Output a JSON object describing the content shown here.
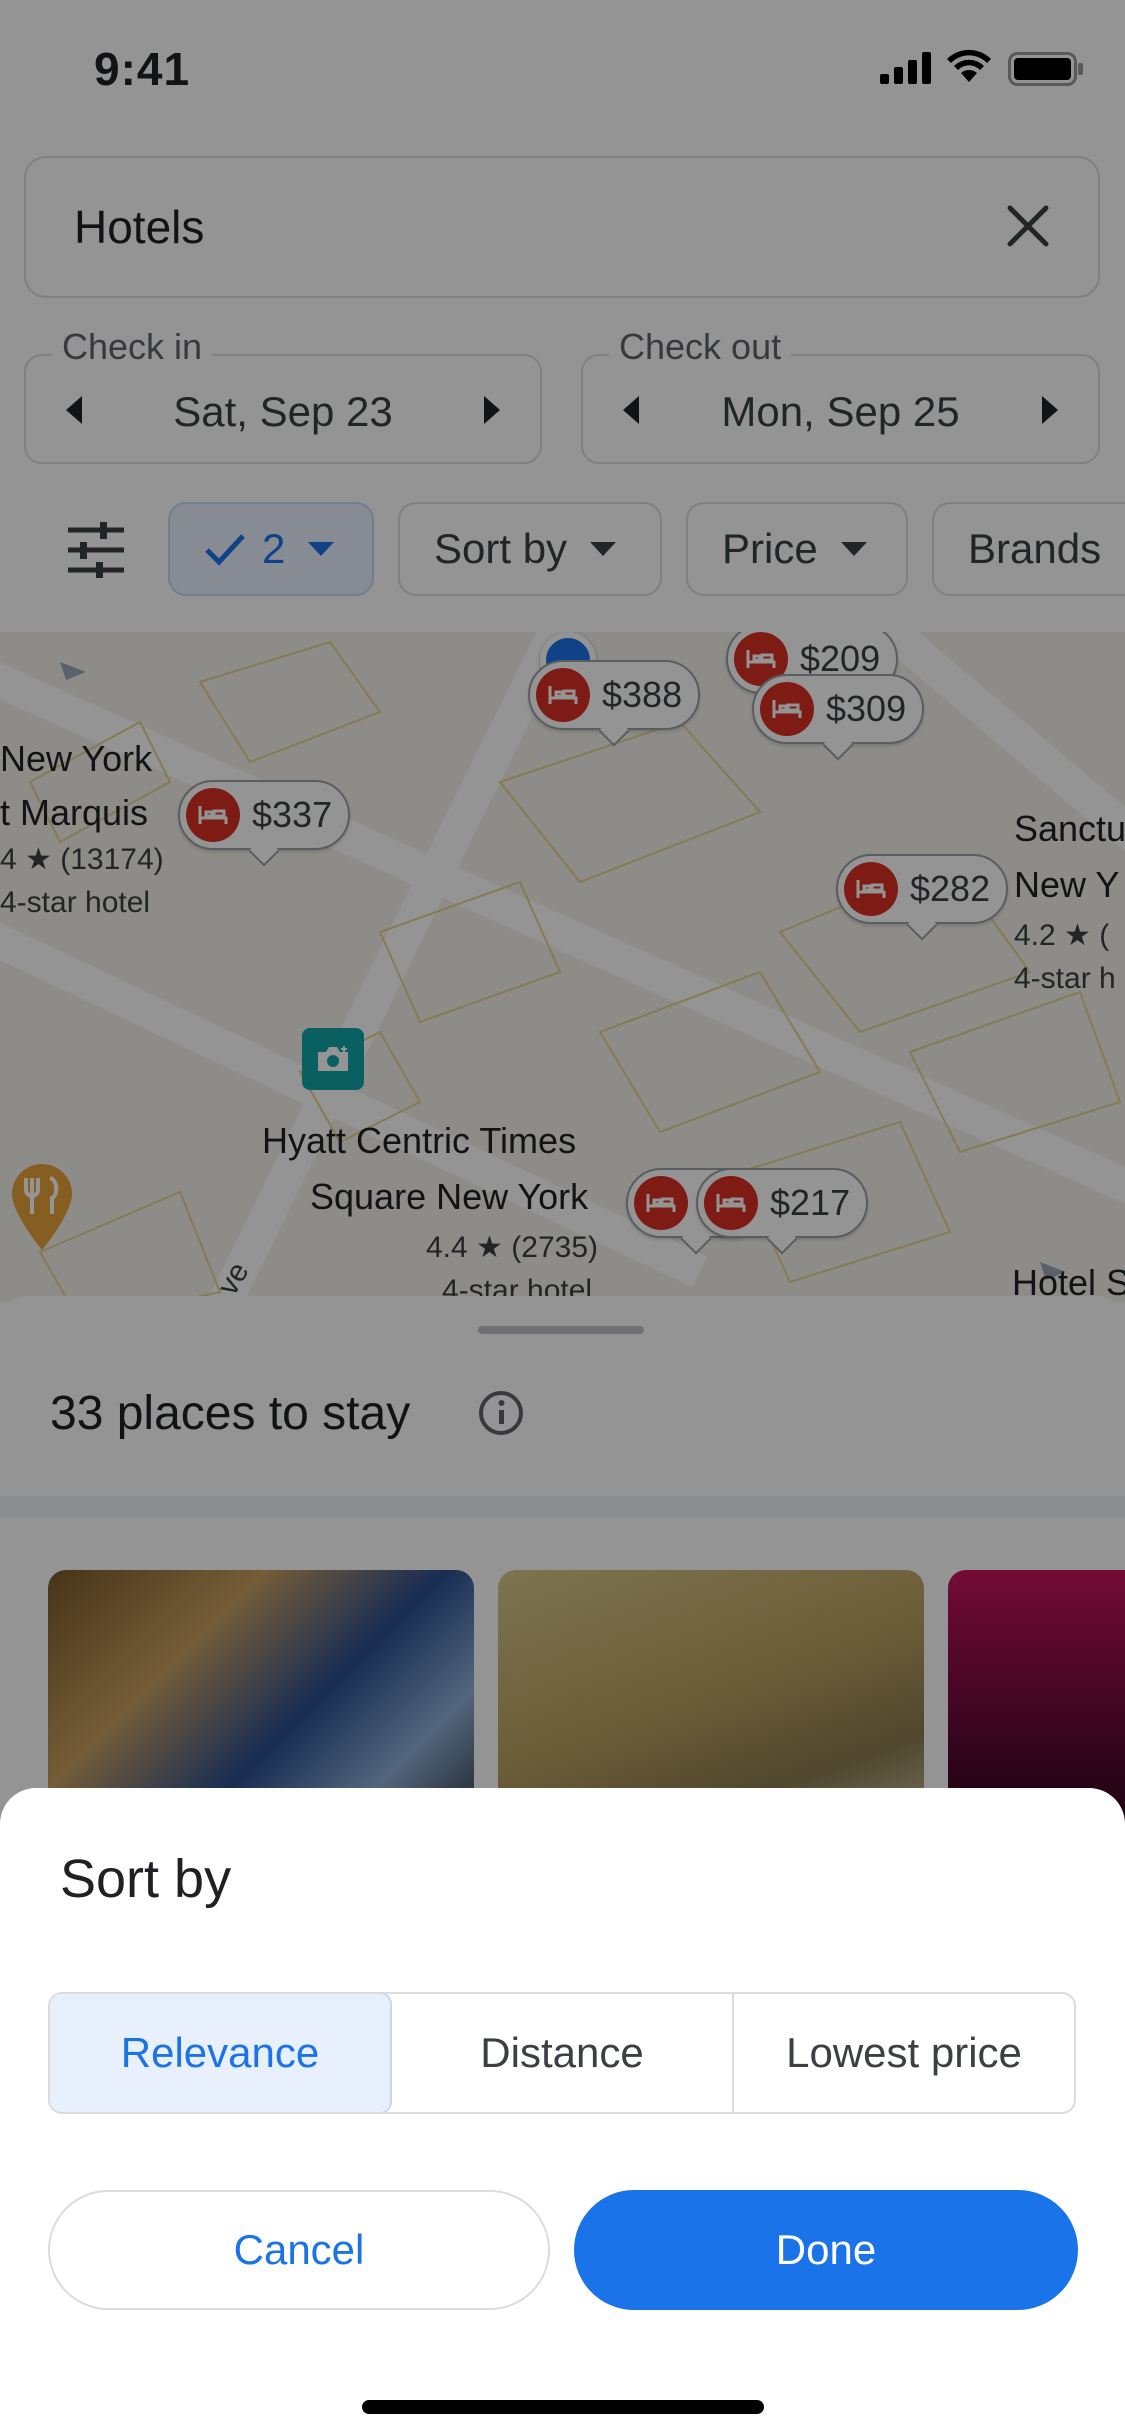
{
  "status_bar": {
    "time": "9:41"
  },
  "search": {
    "query": "Hotels"
  },
  "dates": {
    "check_in": {
      "label": "Check in",
      "value": "Sat, Sep 23"
    },
    "check_out": {
      "label": "Check out",
      "value": "Mon, Sep 25"
    }
  },
  "filters": {
    "guests": "2",
    "sort_by": "Sort by",
    "price": "Price",
    "brands": "Brands"
  },
  "map": {
    "pins": [
      "$388",
      "$209",
      "$309",
      "$337",
      "$282",
      "$217"
    ],
    "labels": {
      "ny_marquis_line1": "New York",
      "ny_marquis_line2": "t Marquis",
      "ny_marquis_rating": "4 ★ (13174)",
      "ny_marquis_class": "4-star hotel",
      "hyatt_line1": "Hyatt Centric Times",
      "hyatt_line2": "Square New York",
      "hyatt_rating": "4.4 ★ (2735)",
      "hyatt_class": "4-star hotel",
      "sanctuary_line1": "Sanctu",
      "sanctuary_line2": "New Y",
      "sanctuary_rating": "4.2 ★ (",
      "sanctuary_class": "4-star h",
      "hotel_s": "Hotel S",
      "street_fragment": "ve"
    }
  },
  "results": {
    "count_text": "33 places to stay"
  },
  "sort_sheet": {
    "title": "Sort by",
    "options": [
      "Relevance",
      "Distance",
      "Lowest price"
    ],
    "selected": "Relevance",
    "cancel": "Cancel",
    "done": "Done"
  },
  "colors": {
    "accent": "#1a73e8",
    "pin_red": "#d93025",
    "selected_bg": "#e8f0fe"
  }
}
